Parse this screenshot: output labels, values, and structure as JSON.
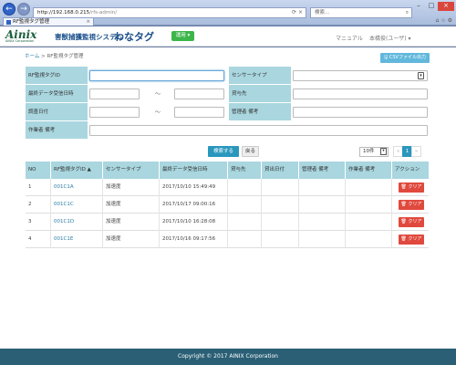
{
  "browser": {
    "url": "http://192.168.0.215",
    "url_rest": "/rfs-admin/",
    "search_placeholder": "検索...",
    "tab_title": "RF監視タグ管理",
    "back_glyph": "←",
    "forward_glyph": "→"
  },
  "header": {
    "logo": "Ainix",
    "logo_sub": "AINIX Corporation",
    "system_name": "害獣捕獲監視システム",
    "product_name": "わなタグ",
    "ops_label": "運用 ▾",
    "manual_label": "マニュアル",
    "user_label": "本橋俊(ユーザ) ▾"
  },
  "breadcrumb": {
    "home": "ホーム",
    "separator": " > ",
    "current": "RF監視タグ管理"
  },
  "csv_button_label": "🖫 CSVファイル出力",
  "form": {
    "tag_id_label": "RF監視タグID",
    "sensor_type_label": "センサータイプ",
    "last_data_label": "最終データ受信日時",
    "lender_label": "貸与先",
    "checked_date_label": "調査日付",
    "manager_note_label": "管理者 備考",
    "worker_note_label": "作業者 備考",
    "tilde": "～"
  },
  "actions": {
    "search_label": "検索する",
    "back_label": "戻る",
    "per_page": "10件"
  },
  "pager": [
    "«",
    "1",
    "»"
  ],
  "table": {
    "headers": [
      "NO",
      "RF監視タグID ▲",
      "センサータイプ",
      "最終データ受信日時",
      "貸与先",
      "貸出日付",
      "管理者 備考",
      "作業者 備考",
      "アクション"
    ],
    "rows": [
      {
        "no": "1",
        "tag_id": "001C1A",
        "sensor": "加速度",
        "last_data": "2017/10/10 15:49:49"
      },
      {
        "no": "2",
        "tag_id": "001C1C",
        "sensor": "加速度",
        "last_data": "2017/10/17 09:00:16"
      },
      {
        "no": "3",
        "tag_id": "001C1D",
        "sensor": "加速度",
        "last_data": "2017/10/10 16:28:08"
      },
      {
        "no": "4",
        "tag_id": "001C1E",
        "sensor": "加速度",
        "last_data": "2017/10/16 09:17:56"
      }
    ],
    "clear_label": "🗑 クリア"
  },
  "footer": "Copyright © 2017 AINIX Corporation"
}
